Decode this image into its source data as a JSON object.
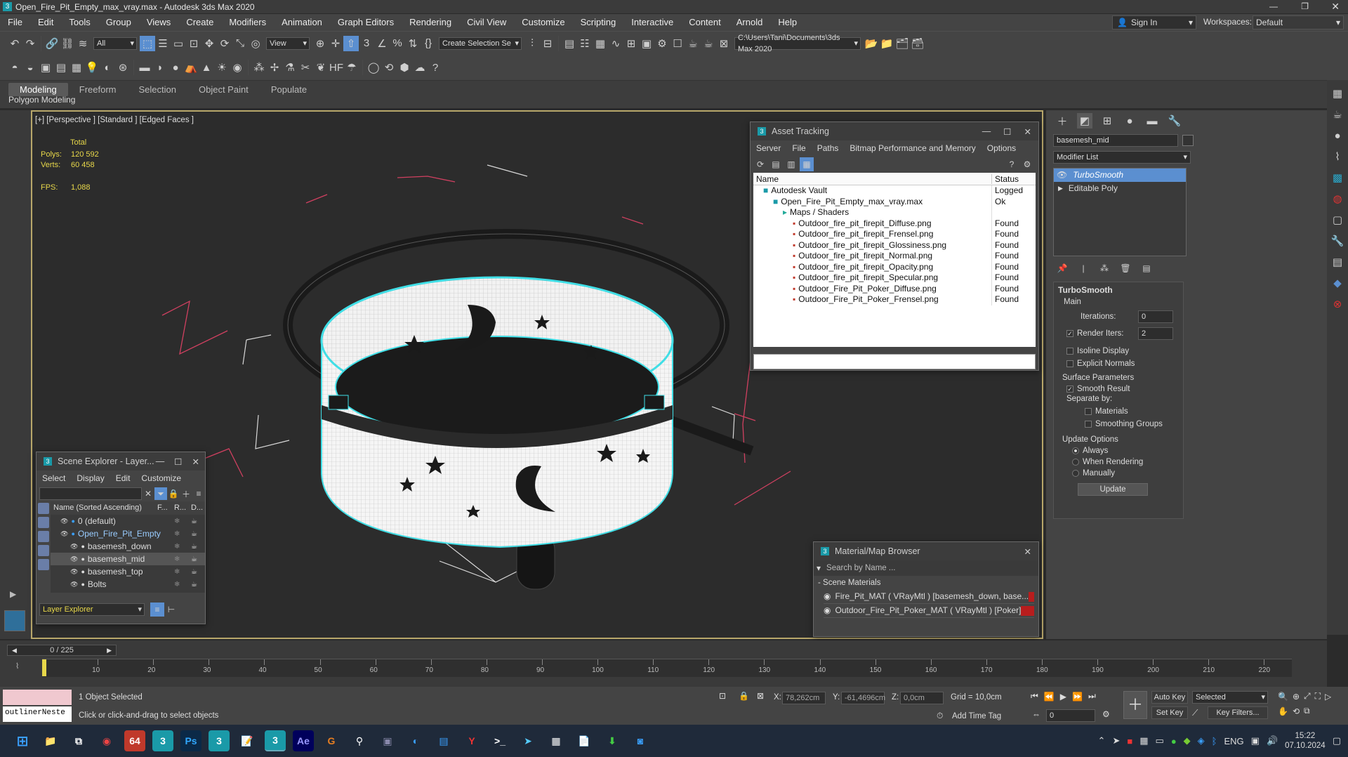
{
  "titlebar": {
    "title": "Open_Fire_Pit_Empty_max_vray.max - Autodesk 3ds Max 2020"
  },
  "menus": [
    "File",
    "Edit",
    "Tools",
    "Group",
    "Views",
    "Create",
    "Modifiers",
    "Animation",
    "Graph Editors",
    "Rendering",
    "Civil View",
    "Customize",
    "Scripting",
    "Interactive",
    "Content",
    "Arnold",
    "Help"
  ],
  "signin": "Sign In",
  "workspaces": {
    "label": "Workspaces:",
    "value": "Default"
  },
  "toolbar": {
    "filter": "All",
    "refcoord": "View",
    "selection_set": "Create Selection Se",
    "project_path": "C:\\Users\\Tani\\Documents\\3ds Max 2020"
  },
  "ribbon": {
    "tabs": [
      "Modeling",
      "Freeform",
      "Selection",
      "Object Paint",
      "Populate"
    ],
    "sub": "Polygon Modeling"
  },
  "viewport": {
    "label": "[+] [Perspective ] [Standard ] [Edged Faces ]",
    "stats_header": "Total",
    "polys_label": "Polys:",
    "polys": "120 592",
    "verts_label": "Verts:",
    "verts": "60 458",
    "fps_label": "FPS:",
    "fps": "1,088"
  },
  "asset_tracking": {
    "title": "Asset Tracking",
    "menu": [
      "Server",
      "File",
      "Paths",
      "Bitmap Performance and Memory",
      "Options"
    ],
    "col_name": "Name",
    "col_status": "Status",
    "rows": [
      {
        "name": "Autodesk Vault",
        "status": "Logged",
        "indent": 1
      },
      {
        "name": "Open_Fire_Pit_Empty_max_vray.max",
        "status": "Ok",
        "indent": 2
      },
      {
        "name": "Maps / Shaders",
        "status": "",
        "indent": 3
      },
      {
        "name": "Outdoor_fire_pit_firepit_Diffuse.png",
        "status": "Found",
        "indent": 4
      },
      {
        "name": "Outdoor_fire_pit_firepit_Frensel.png",
        "status": "Found",
        "indent": 4
      },
      {
        "name": "Outdoor_fire_pit_firepit_Glossiness.png",
        "status": "Found",
        "indent": 4
      },
      {
        "name": "Outdoor_fire_pit_firepit_Normal.png",
        "status": "Found",
        "indent": 4
      },
      {
        "name": "Outdoor_fire_pit_firepit_Opacity.png",
        "status": "Found",
        "indent": 4
      },
      {
        "name": "Outdoor_fire_pit_firepit_Specular.png",
        "status": "Found",
        "indent": 4
      },
      {
        "name": "Outdoor_Fire_Pit_Poker_Diffuse.png",
        "status": "Found",
        "indent": 4
      },
      {
        "name": "Outdoor_Fire_Pit_Poker_Frensel.png",
        "status": "Found",
        "indent": 4
      }
    ]
  },
  "scene_explorer": {
    "title": "Scene Explorer - Layer...",
    "menu": [
      "Select",
      "Display",
      "Edit",
      "Customize"
    ],
    "col_name": "Name (Sorted Ascending)",
    "col_f": "F...",
    "col_r": "R...",
    "col_d": "D...",
    "rows": [
      {
        "name": "0 (default)",
        "indent": 1
      },
      {
        "name": "Open_Fire_Pit_Empty",
        "indent": 1,
        "highlight": true
      },
      {
        "name": "basemesh_down",
        "indent": 2
      },
      {
        "name": "basemesh_mid",
        "indent": 2,
        "selected": true
      },
      {
        "name": "basemesh_top",
        "indent": 2
      },
      {
        "name": "Bolts",
        "indent": 2
      }
    ],
    "footer": "Layer Explorer"
  },
  "material_browser": {
    "title": "Material/Map Browser",
    "search": "Search by Name ...",
    "group": "- Scene Materials",
    "items": [
      "Fire_Pit_MAT ( VRayMtl ) [basemesh_down, base...",
      "Outdoor_Fire_Pit_Poker_MAT ( VRayMtl ) [Poker]"
    ]
  },
  "command_panel": {
    "object_name": "basemesh_mid",
    "modifier_list": "Modifier List",
    "stack": [
      "TurboSmooth",
      "Editable Poly"
    ],
    "rollout": "TurboSmooth",
    "main": "Main",
    "iterations_label": "Iterations:",
    "iterations": "0",
    "render_iters_label": "Render Iters:",
    "render_iters": "2",
    "isoline": "Isoline Display",
    "explicit": "Explicit Normals",
    "surface": "Surface Parameters",
    "smooth": "Smooth Result",
    "separate": "Separate by:",
    "materials": "Materials",
    "smoothing": "Smoothing Groups",
    "update_opts": "Update Options",
    "always": "Always",
    "when_rendering": "When Rendering",
    "manually": "Manually",
    "update_btn": "Update"
  },
  "timeline": {
    "frame": "0 / 225",
    "ticks": [
      "10",
      "20",
      "30",
      "40",
      "50",
      "60",
      "70",
      "80",
      "90",
      "100",
      "110",
      "120",
      "130",
      "140",
      "150",
      "160",
      "170",
      "180",
      "190",
      "200",
      "210",
      "220"
    ]
  },
  "status": {
    "script": "outlinerNeste",
    "selected": "1 Object Selected",
    "hint": "Click or click-and-drag to select objects",
    "x_label": "X:",
    "x": "78,262cm",
    "y_label": "Y:",
    "y": "-61,4696cm",
    "z_label": "Z:",
    "z": "0,0cm",
    "grid": "Grid = 10,0cm",
    "add_time_tag": "Add Time Tag",
    "auto_key": "Auto Key",
    "set_key": "Set Key",
    "key_mode": "Selected",
    "key_filters": "Key Filters...",
    "frame_field": "0"
  },
  "taskbar": {
    "lang": "ENG",
    "time": "15:22",
    "date": "07.10.2024"
  },
  "colors": {
    "accent": "#5b8fd0",
    "wire": "#3fe0e8",
    "selection_box": "#e0e0e0",
    "gizmo": "#d04060"
  }
}
